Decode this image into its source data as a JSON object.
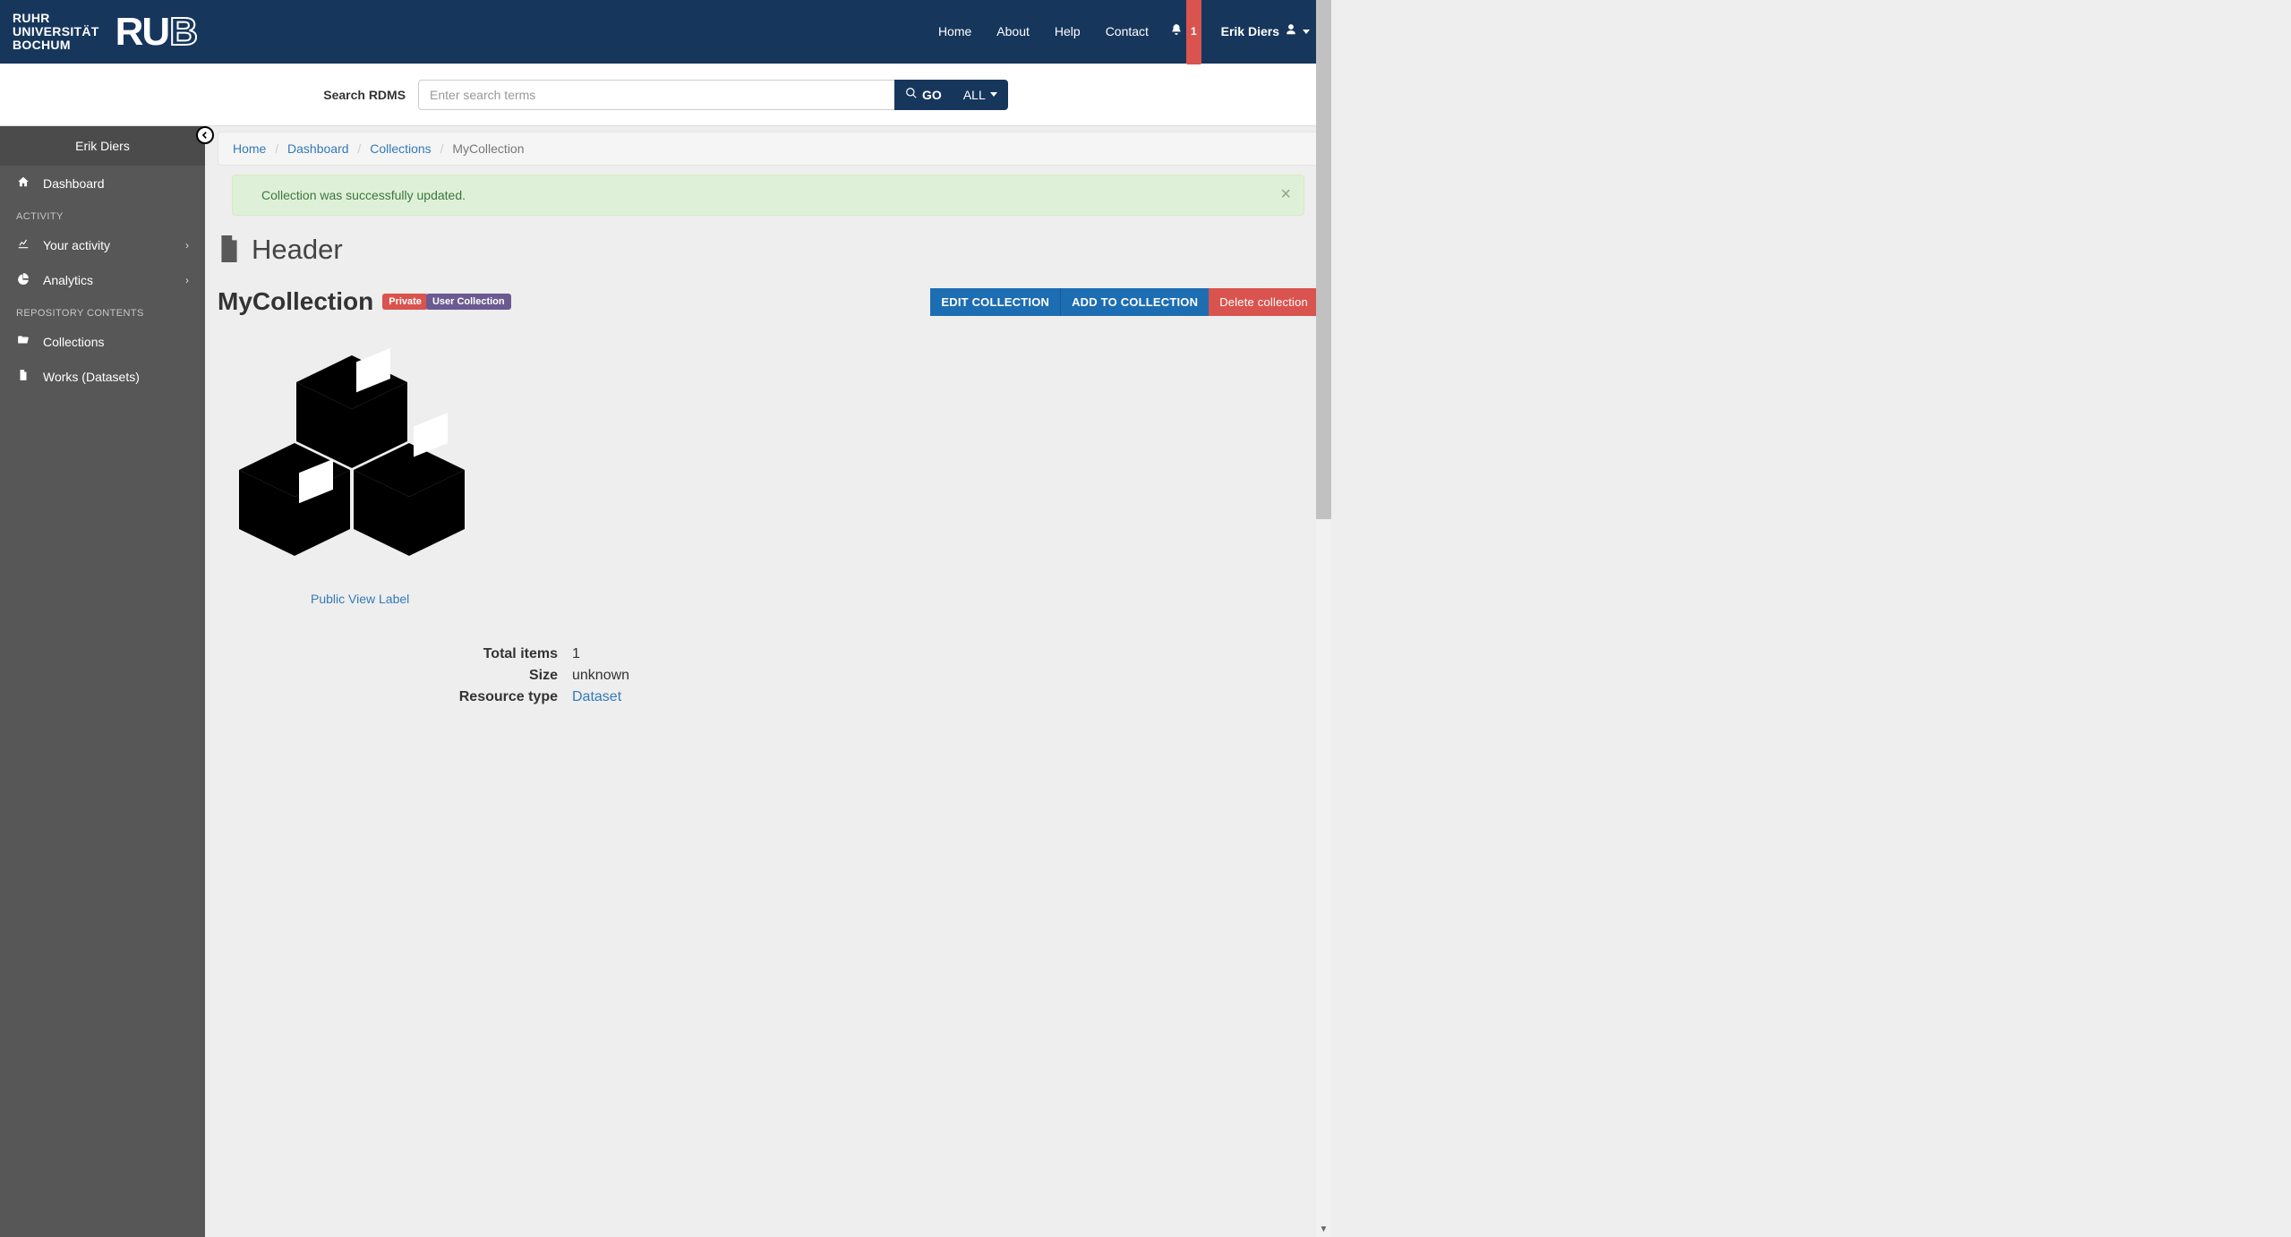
{
  "brand": {
    "line1": "RUHR",
    "line2": "UNIVERSITÄT",
    "line3": "BOCHUM",
    "logo_ru": "RU",
    "logo_b": "B"
  },
  "nav": {
    "home": "Home",
    "about": "About",
    "help": "Help",
    "contact": "Contact",
    "notification_count": "1",
    "username": "Erik Diers"
  },
  "search": {
    "label": "Search RDMS",
    "placeholder": "Enter search terms",
    "go": "GO",
    "scope": "ALL"
  },
  "sidebar": {
    "owner": "Erik Diers",
    "dashboard": "Dashboard",
    "section_activity": "ACTIVITY",
    "your_activity": "Your activity",
    "analytics": "Analytics",
    "section_repo": "REPOSITORY CONTENTS",
    "collections": "Collections",
    "works": "Works (Datasets)"
  },
  "breadcrumb": {
    "home": "Home",
    "dashboard": "Dashboard",
    "collections": "Collections",
    "current": "MyCollection"
  },
  "alert": {
    "message": "Collection was successfully updated.",
    "close": "×"
  },
  "page": {
    "header": "Header",
    "collection_title": "MyCollection",
    "badge_private": "Private",
    "badge_user_collection": "User Collection",
    "public_view_label": "Public View Label"
  },
  "actions": {
    "edit": "EDIT COLLECTION",
    "add": "ADD TO COLLECTION",
    "delete": "Delete collection"
  },
  "meta": {
    "total_items": {
      "label": "Total items",
      "value": "1"
    },
    "size": {
      "label": "Size",
      "value": "unknown"
    },
    "resource_type": {
      "label": "Resource type",
      "value": "Dataset"
    }
  }
}
